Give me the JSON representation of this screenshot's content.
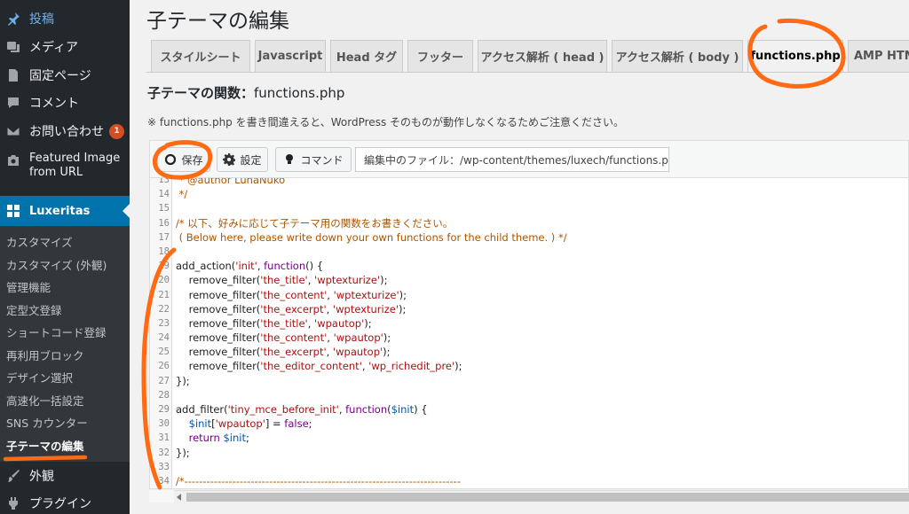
{
  "sidebar": {
    "items": [
      {
        "id": "posts",
        "label": "投稿",
        "icon": "pin-icon"
      },
      {
        "id": "media",
        "label": "メディア",
        "icon": "media-icon"
      },
      {
        "id": "pages",
        "label": "固定ページ",
        "icon": "page-icon"
      },
      {
        "id": "comments",
        "label": "コメント",
        "icon": "comment-icon"
      },
      {
        "id": "contact",
        "label": "お問い合わせ",
        "icon": "mail-icon",
        "badge": "1"
      },
      {
        "id": "featured",
        "label": "Featured Image from URL",
        "icon": "camera-icon"
      }
    ],
    "active": {
      "label": "Luxeritas",
      "icon": "grid-icon"
    },
    "submenu": [
      "カスタマイズ",
      "カスタマイズ (外観)",
      "管理機能",
      "定型文登録",
      "ショートコード登録",
      "再利用ブロック",
      "デザイン選択",
      "高速化一括設定",
      "SNS カウンター",
      "子テーマの編集"
    ],
    "bottom_items": [
      {
        "label": "外観",
        "icon": "brush-icon"
      },
      {
        "label": "プラグイン",
        "icon": "plugin-icon"
      }
    ]
  },
  "main": {
    "title": "子テーマの編集",
    "tabs": [
      "スタイルシート",
      "Javascript",
      "Head タグ",
      "フッター",
      "アクセス解析 ( head )",
      "アクセス解析 ( body )",
      "functions.php",
      "AMP HTML"
    ],
    "active_tab": "functions.php",
    "heading_prefix": "子テーマの関数：",
    "heading_file": "functions.php",
    "notice": "※ functions.php を書き間違えると、WordPress そのものが動作しなくなるためご注意ください。",
    "toolbar": {
      "save": "保存",
      "settings": "設定",
      "command": "コマンド",
      "file_label": "編集中のファイル：/wp-content/themes/luxech/functions.php"
    }
  },
  "editor": {
    "lines": [
      {
        "n": "13",
        "text": " * @author LunaNuko"
      },
      {
        "n": "14",
        "text": " */"
      },
      {
        "n": "15",
        "text": ""
      },
      {
        "n": "16",
        "text": "/* 以下、好みに応じて子テーマ用の関数をお書きください。"
      },
      {
        "n": "17",
        "text": " ( Below here, please write down your own functions for the child theme. ) */"
      },
      {
        "n": "18",
        "text": ""
      },
      {
        "n": "19",
        "text": "add_action('init', function() {"
      },
      {
        "n": "20",
        "text": "    remove_filter('the_title', 'wptexturize');"
      },
      {
        "n": "21",
        "text": "    remove_filter('the_content', 'wptexturize');"
      },
      {
        "n": "22",
        "text": "    remove_filter('the_excerpt', 'wptexturize');"
      },
      {
        "n": "23",
        "text": "    remove_filter('the_title', 'wpautop');"
      },
      {
        "n": "24",
        "text": "    remove_filter('the_content', 'wpautop');"
      },
      {
        "n": "25",
        "text": "    remove_filter('the_excerpt', 'wpautop');"
      },
      {
        "n": "26",
        "text": "    remove_filter('the_editor_content', 'wp_richedit_pre');"
      },
      {
        "n": "27",
        "text": "});"
      },
      {
        "n": "28",
        "text": ""
      },
      {
        "n": "29",
        "text": "add_filter('tiny_mce_before_init', function($init) {"
      },
      {
        "n": "30",
        "text": "    $init['wpautop'] = false;"
      },
      {
        "n": "31",
        "text": "    return $init;"
      },
      {
        "n": "32",
        "text": "});"
      },
      {
        "n": "33",
        "text": ""
      },
      {
        "n": "34",
        "text": "/*---------------------------------------------------------------------------"
      },
      {
        "n": "35",
        "text": ""
      }
    ]
  },
  "colors": {
    "sidebar_bg": "#23282d",
    "submenu_bg": "#32373c",
    "active_blue": "#0073aa",
    "annotation_orange": "#ff6a13",
    "badge": "#d54e21"
  }
}
